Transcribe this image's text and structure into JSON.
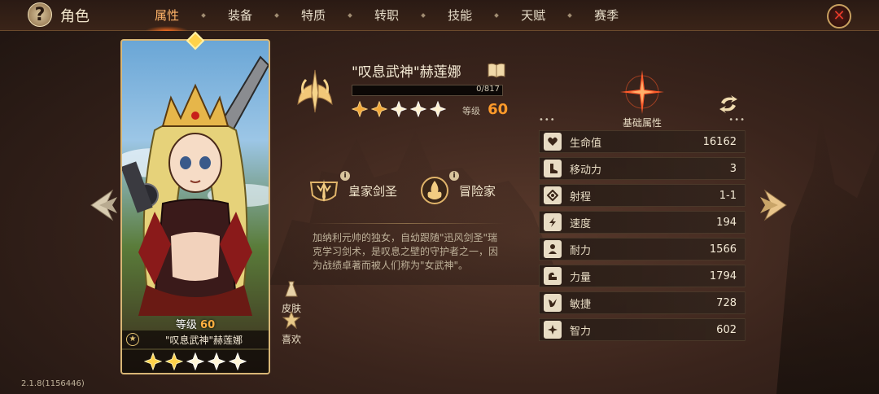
{
  "header": {
    "title": "角色",
    "help_icon": "question-mark-icon",
    "close_icon": "close-x-icon"
  },
  "tabs": [
    {
      "label": "属性",
      "active": true
    },
    {
      "label": "装备",
      "active": false
    },
    {
      "label": "特质",
      "active": false
    },
    {
      "label": "转职",
      "active": false
    },
    {
      "label": "技能",
      "active": false
    },
    {
      "label": "天赋",
      "active": false
    },
    {
      "label": "赛季",
      "active": false
    }
  ],
  "hero": {
    "name": "\"叹息武神\"赫莲娜",
    "exp_text": "0/817",
    "exp_progress": 0,
    "stars": 5,
    "level_label": "等级",
    "level": "60",
    "card_level_label": "等级",
    "card_level": "60",
    "traits": [
      {
        "label": "皇家剑圣",
        "icon": "crown-sword-emblem-icon"
      },
      {
        "label": "冒险家",
        "icon": "flame-emblem-icon"
      }
    ],
    "description": "加纳利元帅的独女，自幼跟随\"迅风剑圣\"瑞克学习剑术，是叹息之壁的守护者之一，因为战绩卓著而被人们称为\"女武神\"。"
  },
  "side_buttons": {
    "skin_label": "皮肤",
    "favorite_label": "喜欢"
  },
  "stats": {
    "header": "基础属性",
    "rows": [
      {
        "label": "生命值",
        "value": "16162",
        "icon": "heart-icon"
      },
      {
        "label": "移动力",
        "value": "3",
        "icon": "boot-icon"
      },
      {
        "label": "射程",
        "value": "1-1",
        "icon": "target-icon"
      },
      {
        "label": "速度",
        "value": "194",
        "icon": "lightning-icon"
      },
      {
        "label": "耐力",
        "value": "1566",
        "icon": "person-icon"
      },
      {
        "label": "力量",
        "value": "1794",
        "icon": "arm-icon"
      },
      {
        "label": "敏捷",
        "value": "728",
        "icon": "agility-icon"
      },
      {
        "label": "智力",
        "value": "602",
        "icon": "sparkle-icon"
      }
    ]
  },
  "footer": {
    "version": "2.1.8(1156446)"
  },
  "colors": {
    "accent": "#ff9a2a",
    "active_tab": "#ffb46a",
    "star": "#ffd24a"
  }
}
